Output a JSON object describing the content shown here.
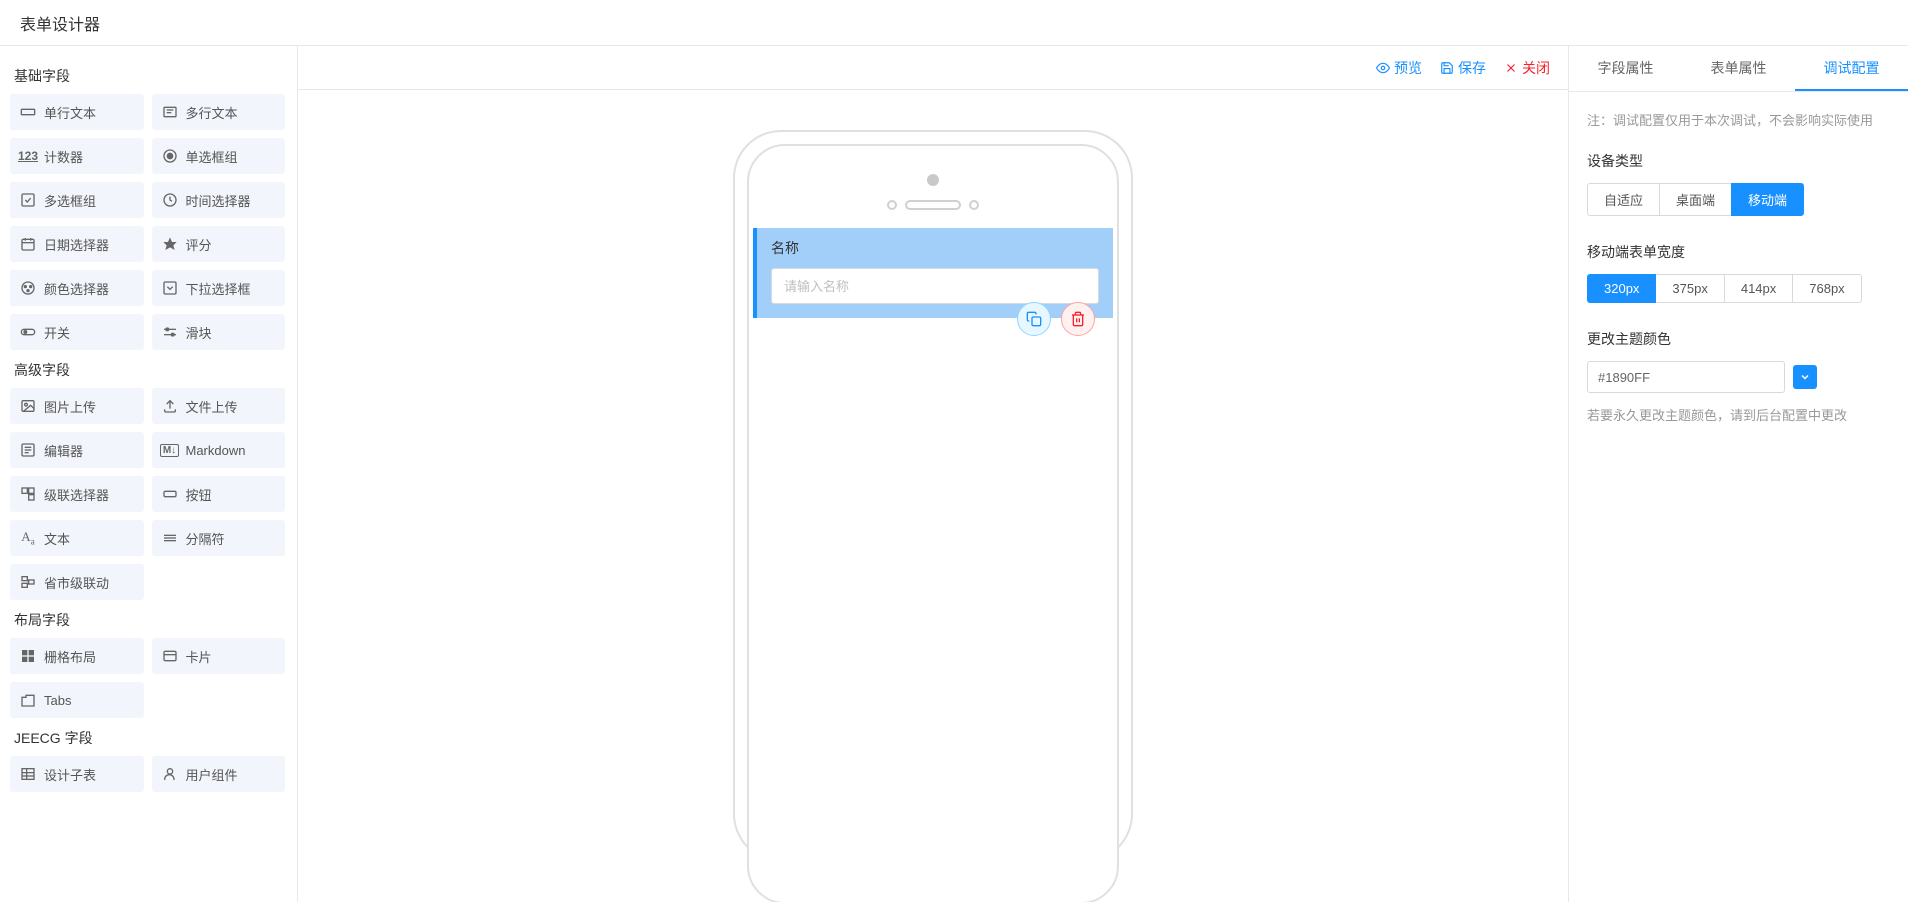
{
  "header": {
    "title": "表单设计器"
  },
  "leftPanel": {
    "sections": [
      {
        "title": "基础字段",
        "items": [
          {
            "icon": "input",
            "label": "单行文本"
          },
          {
            "icon": "textarea",
            "label": "多行文本"
          },
          {
            "icon": "number",
            "label": "计数器"
          },
          {
            "icon": "radio",
            "label": "单选框组"
          },
          {
            "icon": "checkbox",
            "label": "多选框组"
          },
          {
            "icon": "time",
            "label": "时间选择器"
          },
          {
            "icon": "date",
            "label": "日期选择器"
          },
          {
            "icon": "star",
            "label": "评分"
          },
          {
            "icon": "color",
            "label": "颜色选择器"
          },
          {
            "icon": "select",
            "label": "下拉选择框"
          },
          {
            "icon": "switch",
            "label": "开关"
          },
          {
            "icon": "slider",
            "label": "滑块"
          }
        ]
      },
      {
        "title": "高级字段",
        "items": [
          {
            "icon": "image",
            "label": "图片上传"
          },
          {
            "icon": "upload",
            "label": "文件上传"
          },
          {
            "icon": "editor",
            "label": "编辑器"
          },
          {
            "icon": "markdown",
            "label": "Markdown"
          },
          {
            "icon": "cascade",
            "label": "级联选择器"
          },
          {
            "icon": "button",
            "label": "按钮"
          },
          {
            "icon": "text",
            "label": "文本"
          },
          {
            "icon": "divider",
            "label": "分隔符"
          },
          {
            "icon": "region",
            "label": "省市级联动"
          }
        ]
      },
      {
        "title": "布局字段",
        "items": [
          {
            "icon": "grid",
            "label": "栅格布局"
          },
          {
            "icon": "card",
            "label": "卡片"
          },
          {
            "icon": "tabs",
            "label": "Tabs"
          }
        ]
      },
      {
        "title": "JEECG 字段",
        "items": [
          {
            "icon": "subtable",
            "label": "设计子表"
          },
          {
            "icon": "user",
            "label": "用户组件"
          }
        ]
      }
    ]
  },
  "toolbar": {
    "preview": "预览",
    "save": "保存",
    "close": "关闭"
  },
  "canvas": {
    "field": {
      "label": "名称",
      "placeholder": "请输入名称"
    }
  },
  "rightPanel": {
    "tabs": [
      "字段属性",
      "表单属性",
      "调试配置"
    ],
    "activeTab": 2,
    "note": "注：调试配置仅用于本次调试，不会影响实际使用",
    "deviceType": {
      "label": "设备类型",
      "options": [
        "自适应",
        "桌面端",
        "移动端"
      ],
      "active": 2
    },
    "mobileWidth": {
      "label": "移动端表单宽度",
      "options": [
        "320px",
        "375px",
        "414px",
        "768px"
      ],
      "active": 0
    },
    "themeColor": {
      "label": "更改主题颜色",
      "value": "#1890FF",
      "hint": "若要永久更改主题颜色，请到后台配置中更改"
    }
  }
}
